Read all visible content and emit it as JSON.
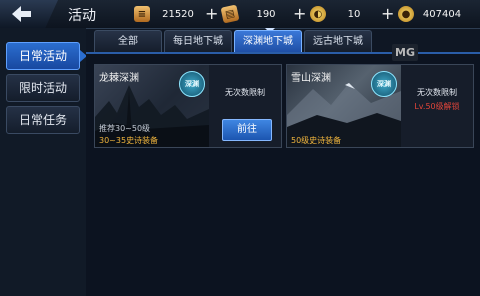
{
  "header": {
    "title": "活动",
    "resources": [
      {
        "icon": "scroll-icon",
        "value": "21520"
      },
      {
        "icon": "ticket-icon",
        "value": "190"
      },
      {
        "icon": "coin-icon",
        "value": "10"
      },
      {
        "icon": "gold-coin-icon",
        "value": "407404"
      }
    ],
    "plus": "+"
  },
  "sidebar": {
    "items": [
      {
        "label": "日常活动",
        "active": true
      },
      {
        "label": "限时活动",
        "active": false
      },
      {
        "label": "日常任务",
        "active": false
      }
    ]
  },
  "tabs": [
    {
      "label": "全部",
      "active": false
    },
    {
      "label": "每日地下城",
      "active": false
    },
    {
      "label": "深渊地下城",
      "active": true
    },
    {
      "label": "远古地下城",
      "active": false
    }
  ],
  "watermark": "MG",
  "cards": [
    {
      "name": "龙棘深渊",
      "badge": "深渊",
      "recommend": "推荐30~50级",
      "gear": "30~35史诗装备",
      "limit": "无次数限制",
      "button": "前往"
    },
    {
      "name": "雪山深渊",
      "badge": "深渊",
      "gear": "50级史诗装备",
      "limit": "无次数限制",
      "unlock": "Lv.50级解锁"
    }
  ],
  "colors": {
    "accent": "#2b6ed0",
    "gear_text": "#f2b63d",
    "locked_text": "#e0453a"
  }
}
